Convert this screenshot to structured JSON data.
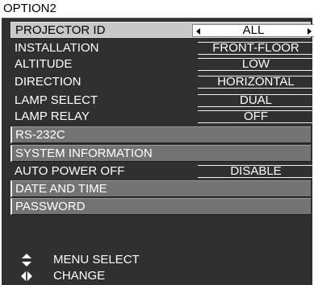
{
  "menu": {
    "title": "OPTION2",
    "items": [
      {
        "label": "PROJECTOR ID",
        "value": "ALL"
      },
      {
        "label": "INSTALLATION",
        "value": "FRONT-FLOOR"
      },
      {
        "label": "ALTITUDE",
        "value": "LOW"
      },
      {
        "label": "DIRECTION",
        "value": "HORIZONTAL"
      },
      {
        "label": "LAMP SELECT",
        "value": "DUAL"
      },
      {
        "label": "LAMP RELAY",
        "value": "OFF"
      },
      {
        "label": "RS-232C"
      },
      {
        "label": "SYSTEM INFORMATION"
      },
      {
        "label": "AUTO POWER OFF",
        "value": "DISABLE"
      },
      {
        "label": "DATE AND TIME"
      },
      {
        "label": "PASSWORD"
      }
    ]
  },
  "legend": {
    "menu_select": "MENU SELECT",
    "change": "CHANGE"
  },
  "icons": {
    "menu_select": "up-down-arrows-icon",
    "change": "left-right-arrows-icon"
  },
  "colors": {
    "background": "#303030",
    "selected_row": "#c8c8c8",
    "submenu_row": "#737373",
    "text": "#ffffff"
  }
}
